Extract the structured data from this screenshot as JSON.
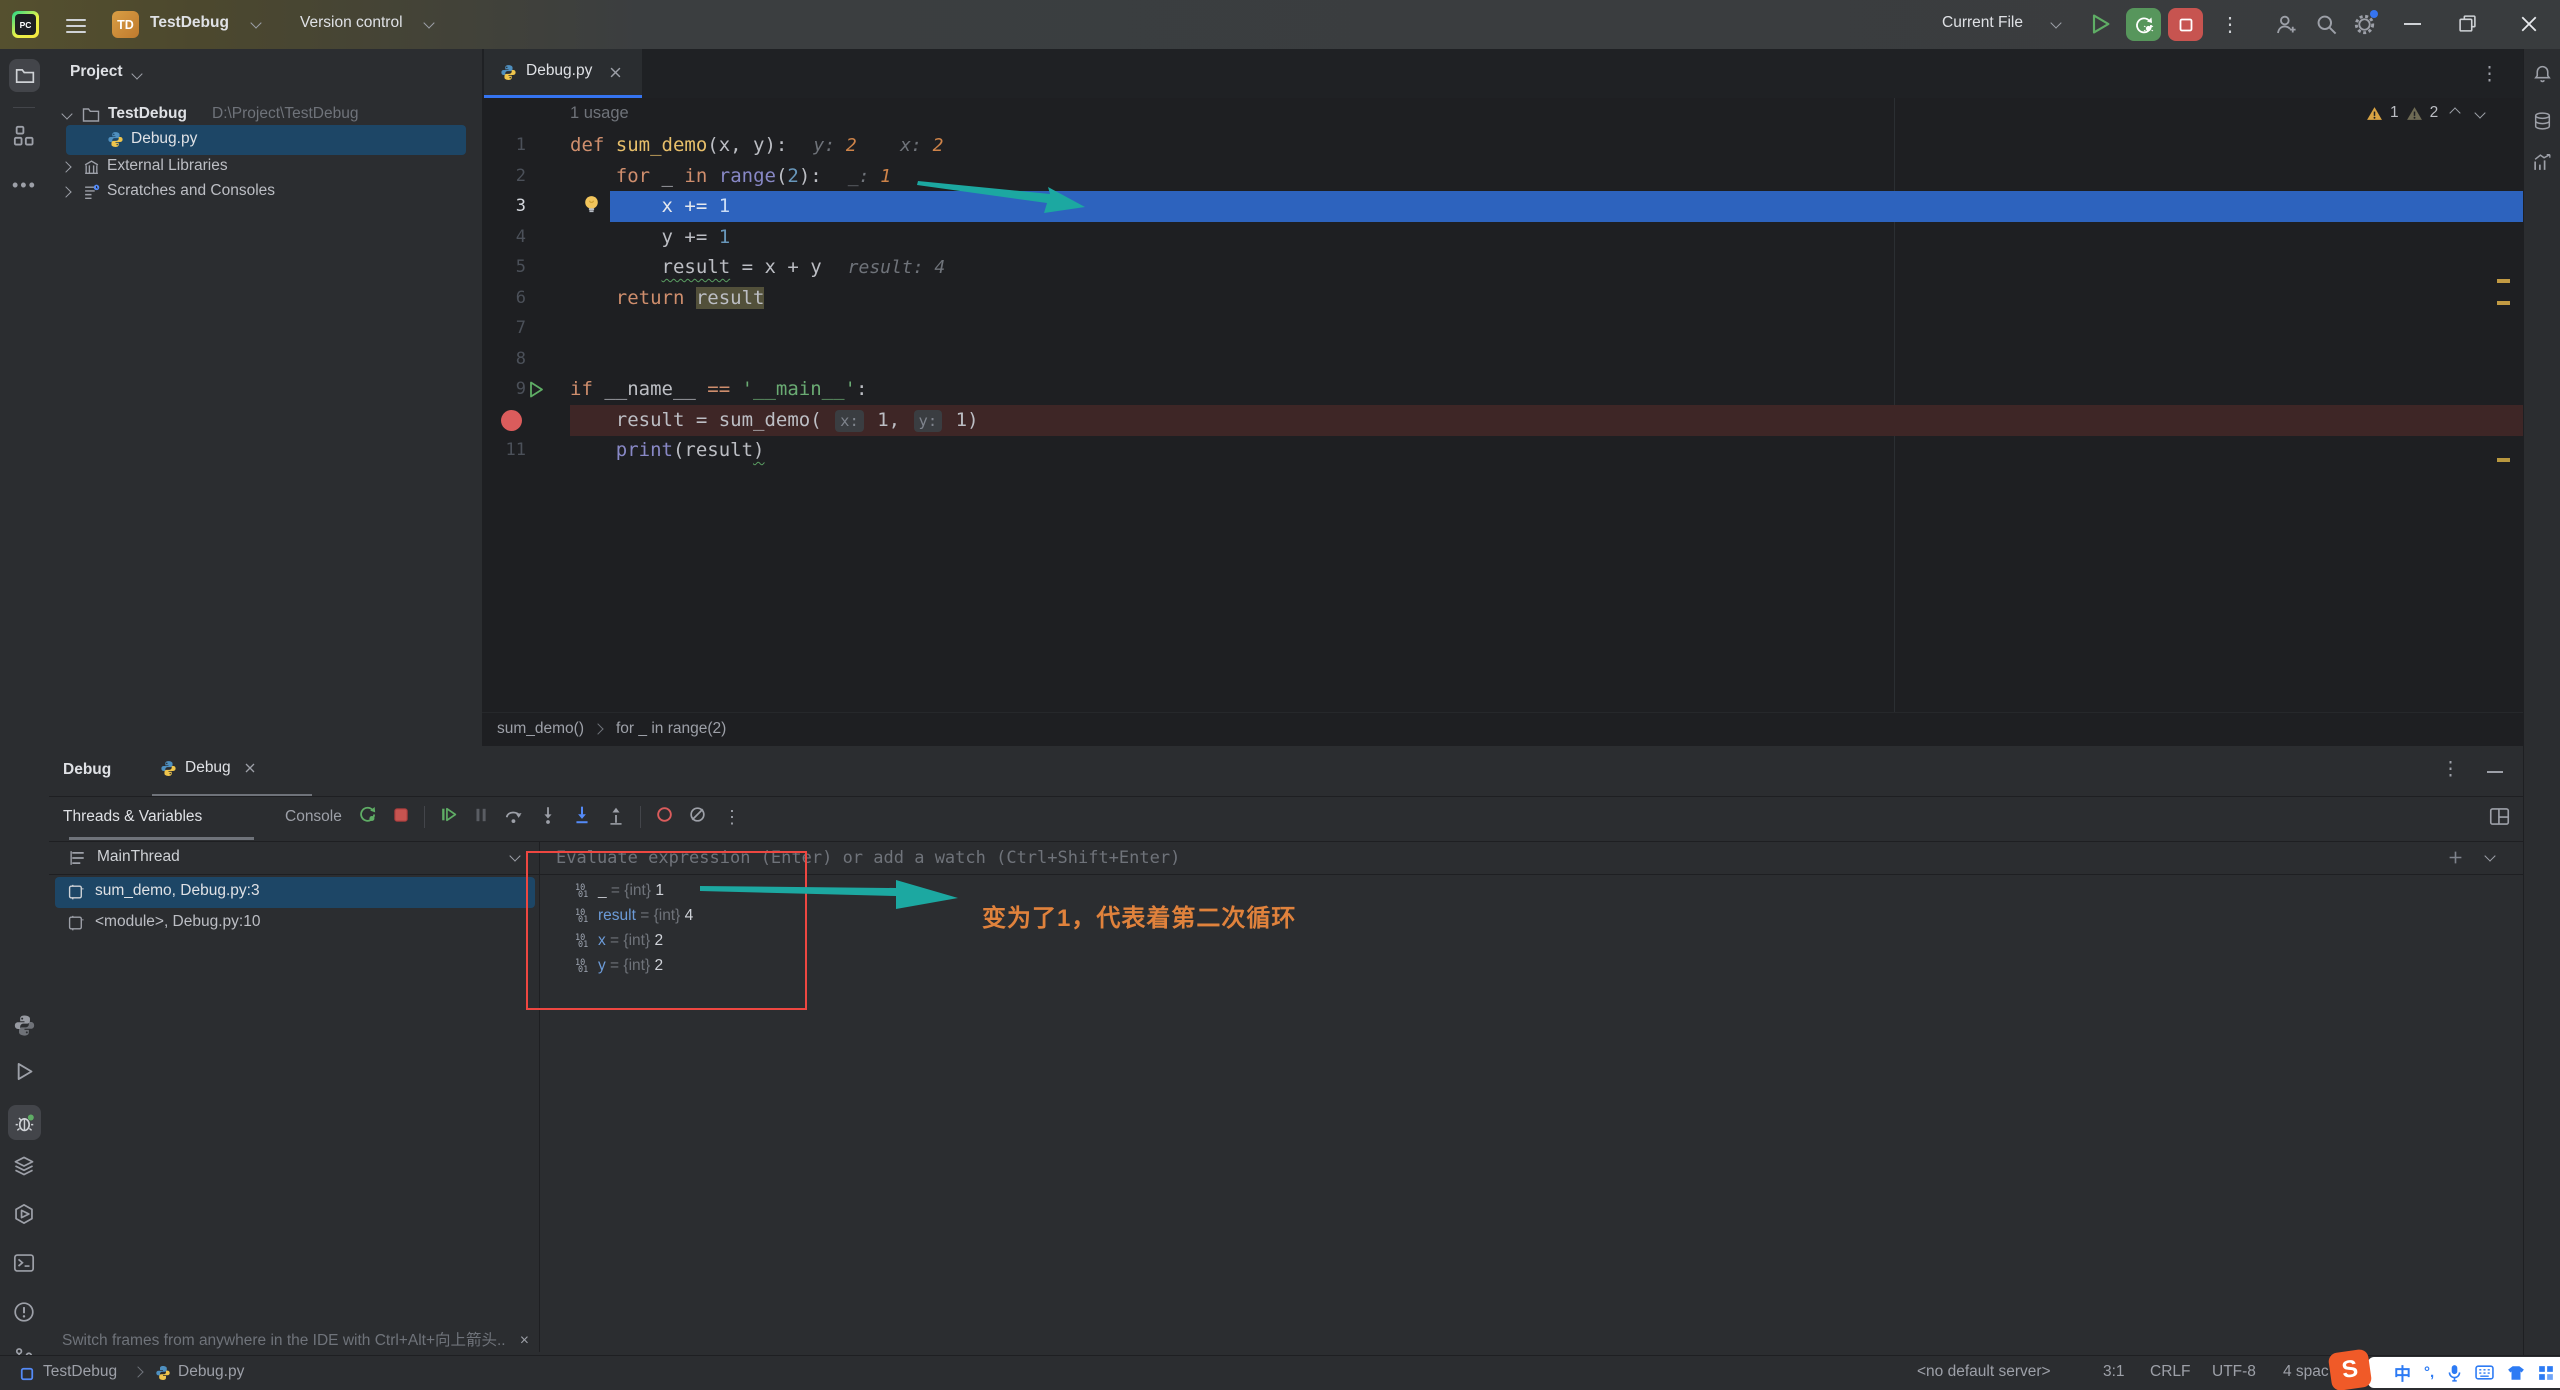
{
  "title_bar": {
    "project_badge": "TD",
    "project_name": "TestDebug",
    "vcs_label": "Version control",
    "run_config": "Current File"
  },
  "project": {
    "header": "Project",
    "root_label": "TestDebug",
    "root_path": "D:\\Project\\TestDebug",
    "file": "Debug.py",
    "external": "External Libraries",
    "scratches": "Scratches and Consoles"
  },
  "editor": {
    "tab_label": "Debug.py",
    "usages": "1 usage",
    "inspections": {
      "warn1": "1",
      "warn2": "2"
    },
    "breadcrumbs": [
      "sum_demo()",
      "for _ in range(2)"
    ],
    "code_lines": [
      {
        "num": 1,
        "tokens": [
          [
            "def ",
            "kw"
          ],
          [
            "sum_demo",
            "fn"
          ],
          [
            "(x, y):",
            "d"
          ]
        ],
        "hints": [
          [
            "y: ",
            "hl"
          ],
          [
            "2",
            "hv"
          ],
          [
            "    x: ",
            "hl"
          ],
          [
            "2",
            "hv"
          ]
        ]
      },
      {
        "num": 2,
        "tokens": [
          [
            "    ",
            "d"
          ],
          [
            "for ",
            "kw"
          ],
          [
            "_ ",
            "d"
          ],
          [
            "in ",
            "kw"
          ],
          [
            "range",
            "bi"
          ],
          [
            "(",
            "d"
          ],
          [
            "2",
            "num"
          ],
          [
            "):",
            "d"
          ]
        ],
        "hints": [
          [
            "_: ",
            "hl"
          ],
          [
            "1",
            "hv"
          ]
        ]
      },
      {
        "num": 3,
        "cur": true,
        "band": "exec",
        "tokens": [
          [
            "        x += ",
            "d"
          ],
          [
            "1",
            "num"
          ]
        ]
      },
      {
        "num": 4,
        "tokens": [
          [
            "        y += ",
            "d"
          ],
          [
            "1",
            "num"
          ]
        ]
      },
      {
        "num": 5,
        "tokens": [
          [
            "        ",
            "d"
          ],
          [
            "result",
            "warn"
          ],
          [
            " = x + y",
            "d"
          ]
        ],
        "hints": [
          [
            "result: 4",
            "hl"
          ]
        ]
      },
      {
        "num": 6,
        "tokens": [
          [
            "    ",
            "d"
          ],
          [
            "return ",
            "kw"
          ],
          [
            "result",
            "caret"
          ]
        ]
      },
      {
        "num": 7,
        "tokens": []
      },
      {
        "num": 8,
        "tokens": []
      },
      {
        "num": 9,
        "play": true,
        "tokens": [
          [
            "if ",
            "kw"
          ],
          [
            "__name__ ",
            "d"
          ],
          [
            "== ",
            "kw"
          ],
          [
            "'__main__'",
            "str"
          ],
          [
            ":",
            "d"
          ]
        ]
      },
      {
        "num": 10,
        "bp": true,
        "band": "bp",
        "tokens": [
          [
            "    result = sum_demo( ",
            "d"
          ],
          [
            "x:",
            "chip"
          ],
          [
            " 1, ",
            "d"
          ],
          [
            "y:",
            "chip"
          ],
          [
            " 1)",
            "d"
          ]
        ]
      },
      {
        "num": 11,
        "tokens": [
          [
            "    ",
            "d"
          ],
          [
            "print",
            "bi"
          ],
          [
            "(result",
            "d"
          ],
          [
            ")",
            "squig"
          ]
        ]
      }
    ]
  },
  "debug": {
    "window_title": "Debug",
    "tab_label": "Debug",
    "tabs": [
      "Threads & Variables",
      "Console"
    ],
    "thread": "MainThread",
    "frames": [
      {
        "label": "sum_demo, Debug.py:3"
      },
      {
        "label": "<module>, Debug.py:10"
      }
    ],
    "evaluate_placeholder": "Evaluate expression (Enter) or add a watch (Ctrl+Shift+Enter)",
    "variables": [
      {
        "name": "_",
        "type": "{int}",
        "value": "1"
      },
      {
        "name": "result",
        "type": "{int}",
        "value": "4"
      },
      {
        "name": "x",
        "type": "{int}",
        "value": "2"
      },
      {
        "name": "y",
        "type": "{int}",
        "value": "2"
      }
    ],
    "hint": "Switch frames from anywhere in the IDE with Ctrl+Alt+向上箭头..",
    "hint_close": "×"
  },
  "annotation": {
    "note": "变为了1，代表着第二次循环"
  },
  "status": {
    "project": "TestDebug",
    "file": "Debug.py",
    "server": "<no default server>",
    "position": "3:1",
    "line_ending": "CRLF",
    "encoding": "UTF-8",
    "indent": "4 spac"
  },
  "colors": {
    "accent_blue": "#3574F0",
    "exec_line": "#2D63BE",
    "breakpoint_red": "#DB5C5C",
    "annotation_red": "#EE4741",
    "annotation_teal": "#1CA8A1",
    "annotation_orange": "#E0823C"
  }
}
